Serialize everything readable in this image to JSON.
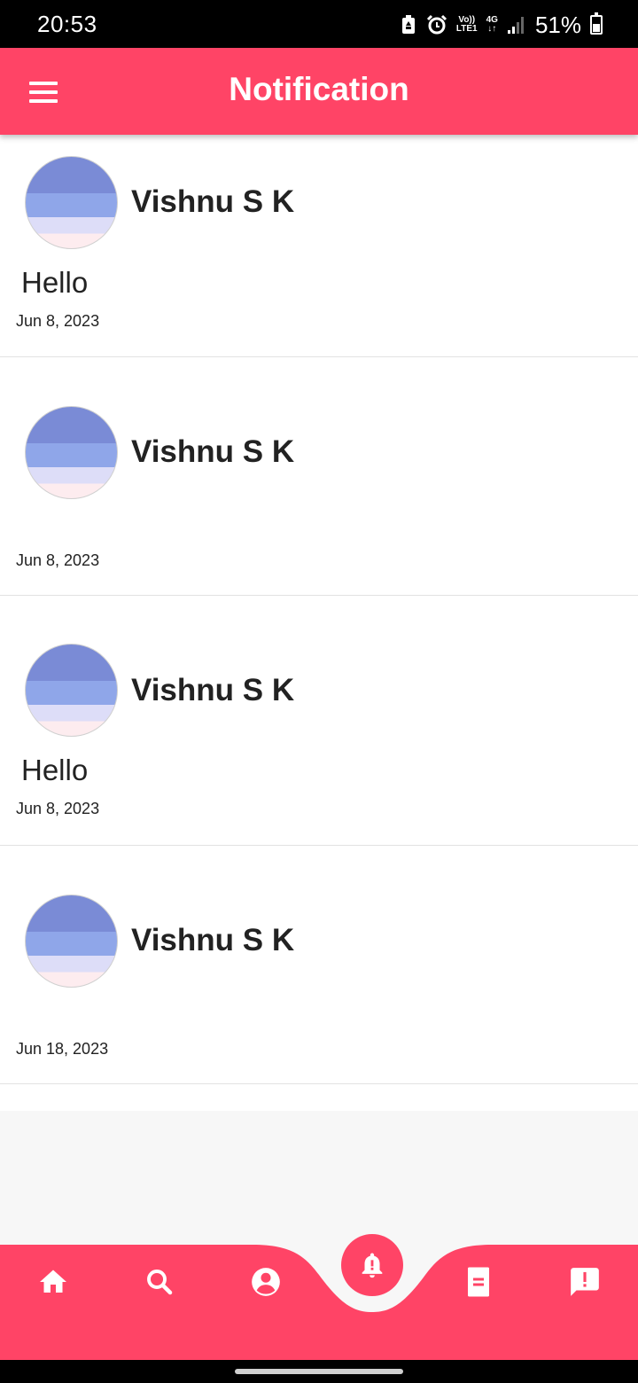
{
  "status_bar": {
    "time": "20:53",
    "network_top": "Vo))",
    "network_bottom": "LTE1",
    "signal_type": "4G",
    "battery": "51%"
  },
  "app_bar": {
    "title": "Notification",
    "menu_icon": "hamburger-menu-icon",
    "color": "#ff4466"
  },
  "notifications": [
    {
      "name": "Vishnu S K",
      "message": "Hello",
      "date": "Jun 8, 2023"
    },
    {
      "name": "Vishnu S K",
      "message": "",
      "date": "Jun 8, 2023"
    },
    {
      "name": "Vishnu S K",
      "message": "Hello",
      "date": "Jun 8, 2023"
    },
    {
      "name": "Vishnu S K",
      "message": "",
      "date": "Jun 18, 2023"
    }
  ],
  "bottom_nav": {
    "items": [
      "home-icon",
      "search-icon",
      "account-icon",
      "notification-bell-icon",
      "document-icon",
      "feedback-icon"
    ],
    "active": "notification-bell-icon"
  }
}
